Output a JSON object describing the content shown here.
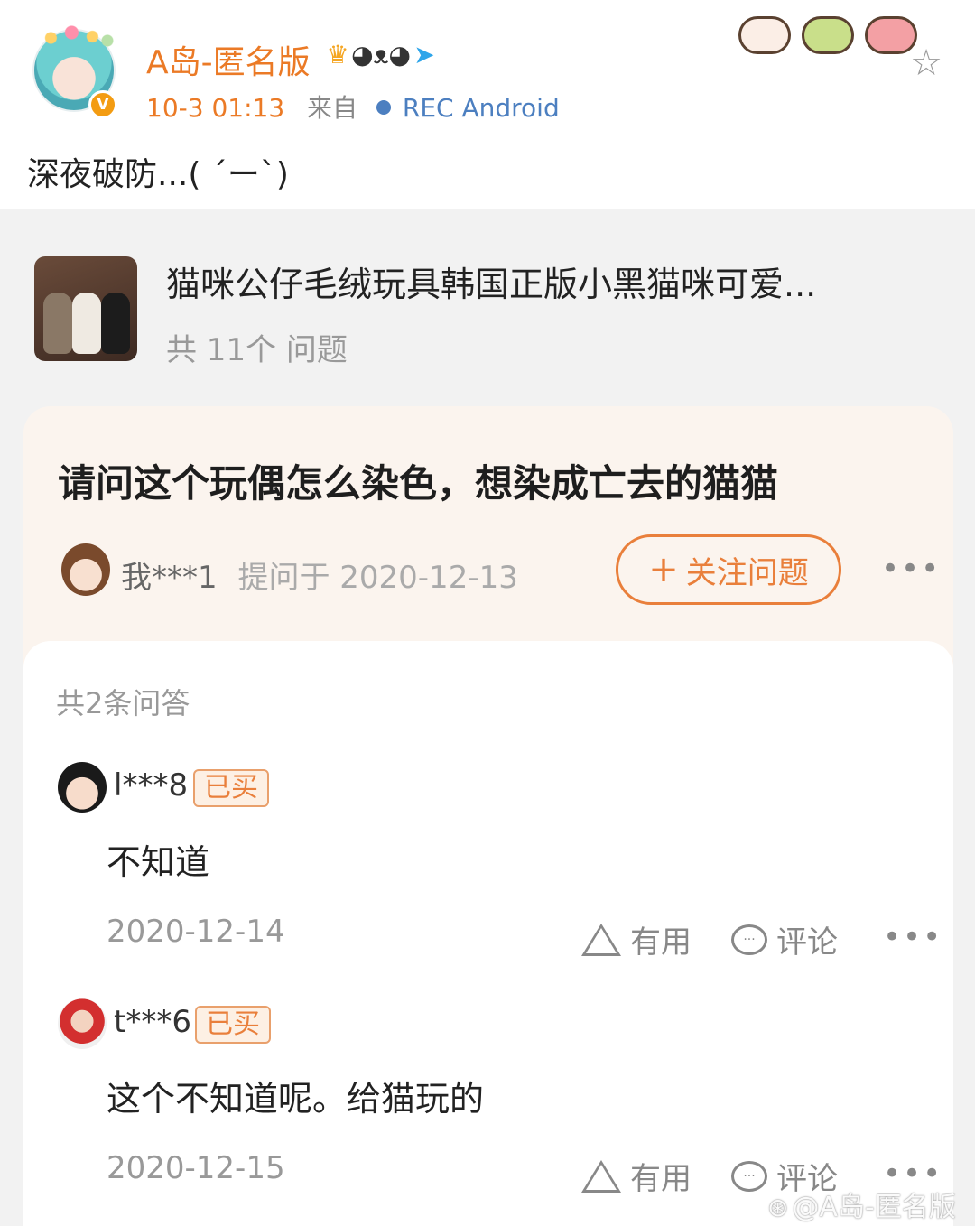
{
  "post": {
    "author": "A岛-匿名版",
    "verified_badge": "V",
    "time": "10-3 01:13",
    "from_label": "来自",
    "device": "REC  Android",
    "text": "深夜破防...( ´ー`)",
    "icons": [
      "crown-icon",
      "panda-icon",
      "paper-plane-icon"
    ],
    "stickers": [
      "bear-sticker",
      "frog-sticker",
      "pig-sticker"
    ],
    "star_icon": "☆"
  },
  "product": {
    "title": "猫咪公仔毛绒玩具韩国正版小黑猫咪可爱...",
    "subtitle": "共 11个 问题"
  },
  "question": {
    "title": "请问这个玩偶怎么染色，想染成亡去的猫猫",
    "asker": "我***1",
    "asked_on": "提问于 2020-12-13",
    "follow_label": "关注问题",
    "follow_plus": "+",
    "more": "•••"
  },
  "answers": {
    "count_label": "共2条问答",
    "items": [
      {
        "user": "l***8",
        "badge": "已买",
        "content": "不知道",
        "date": "2020-12-14",
        "useful_label": "有用",
        "comment_label": "评论",
        "more": "•••"
      },
      {
        "user": "t***6",
        "badge": "已买",
        "content": "这个不知道呢。给猫玩的",
        "date": "2020-12-15",
        "useful_label": "有用",
        "comment_label": "评论",
        "more": "•••"
      }
    ]
  },
  "watermark": "@A岛-匿名版",
  "colors": {
    "accent": "#eb7a26",
    "link": "#4c7fc0",
    "card_bg": "#fbf4ee",
    "page_bg": "#f2f2f2"
  }
}
